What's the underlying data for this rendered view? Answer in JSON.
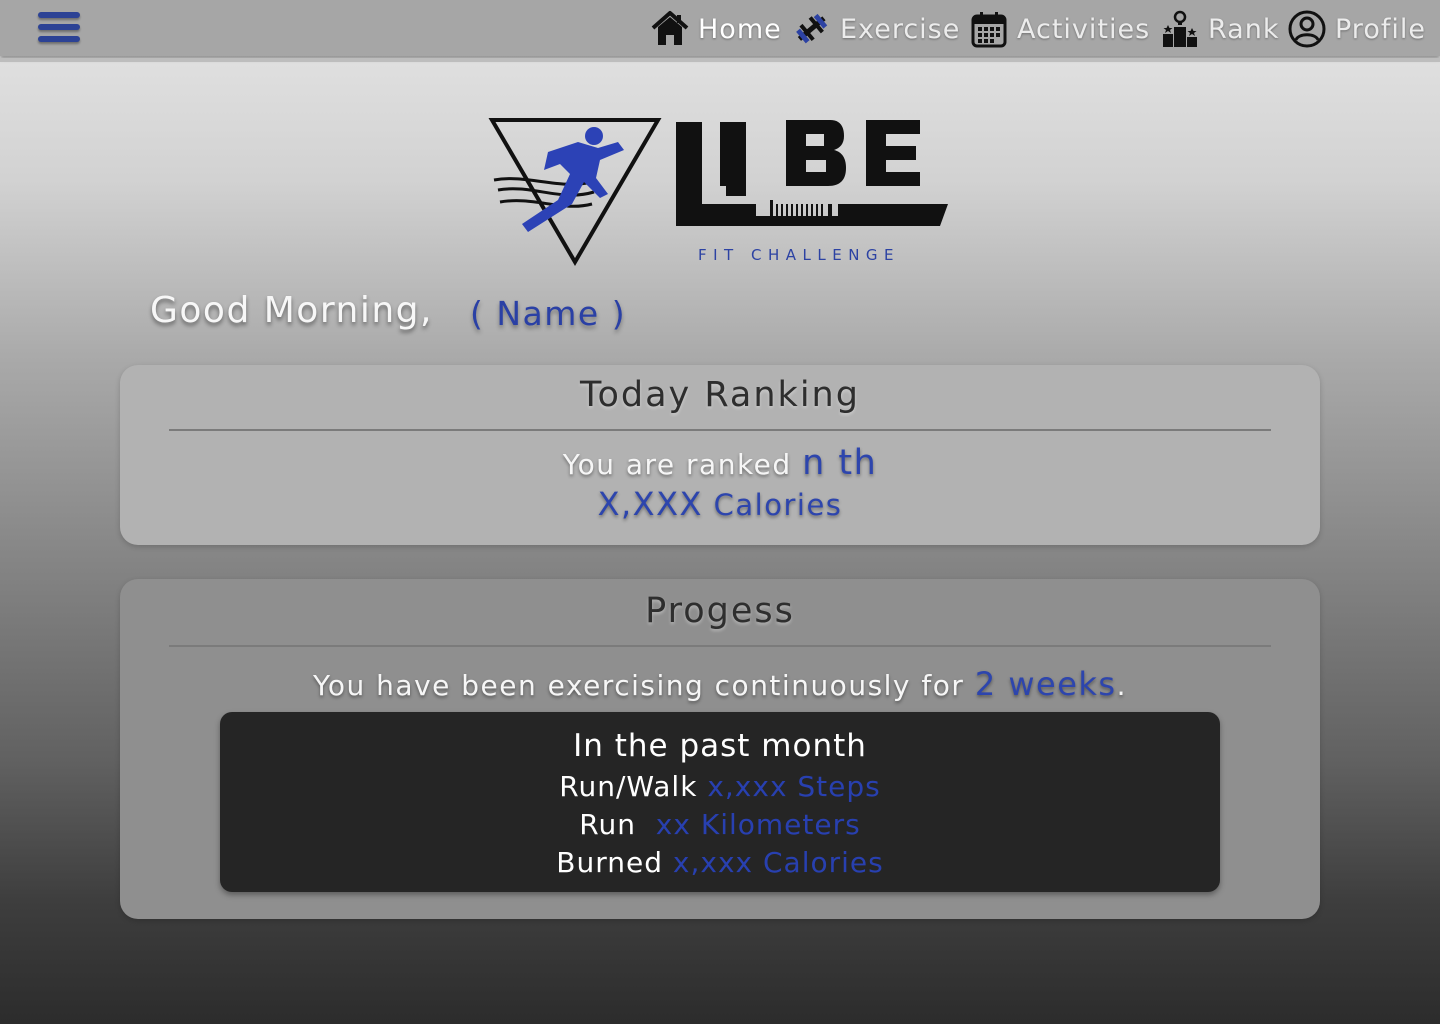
{
  "nav": {
    "items": [
      {
        "label": "Home",
        "icon": "home-icon",
        "active": true
      },
      {
        "label": "Exercise",
        "icon": "dumbbell-icon",
        "active": false
      },
      {
        "label": "Activities",
        "icon": "calendar-icon",
        "active": false
      },
      {
        "label": "Rank",
        "icon": "podium-icon",
        "active": false
      },
      {
        "label": "Profile",
        "icon": "user-circle-icon",
        "active": false
      }
    ]
  },
  "logo": {
    "wordmark": "UBE",
    "subtitle": "FIT CHALLENGE"
  },
  "greeting": {
    "text": "Good Morning,",
    "name": "( Name )"
  },
  "ranking": {
    "title": "Today Ranking",
    "prefix": "You are ranked",
    "rank": "n th",
    "calories_value": "X,XXX",
    "calories_unit": "Calories"
  },
  "progress": {
    "title": "Progess",
    "streak_prefix": "You have been exercising continuously for",
    "streak_value": "2 weeks",
    "streak_suffix": ".",
    "month": {
      "heading": "In the past month",
      "rows": [
        {
          "label": "Run/Walk",
          "value": "x,xxx Steps"
        },
        {
          "label": "Run",
          "value": "xx Kilometers"
        },
        {
          "label": "Burned",
          "value": "x,xxx Calories"
        }
      ]
    }
  },
  "colors": {
    "accent": "#2c42a3",
    "topbar": "#a6a6a6",
    "stats_panel": "#252525"
  }
}
